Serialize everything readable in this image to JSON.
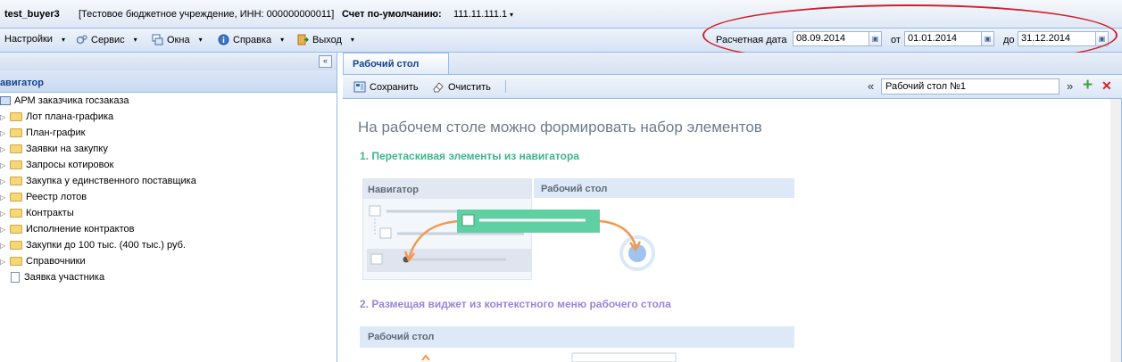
{
  "topbar": {
    "user": "test_buyer3",
    "org": "[Тестовое бюджетное учреждение, ИНН: 000000000011]",
    "account_label": "Счет по-умолчанию:",
    "account_value": "111.11.111.1",
    "account_caret": "▾"
  },
  "menu": {
    "items": [
      {
        "label": "Настройки",
        "icon": "settings-icon"
      },
      {
        "label": "Сервис",
        "icon": "service-icon"
      },
      {
        "label": "Окна",
        "icon": "windows-icon"
      },
      {
        "label": "Справка",
        "icon": "info-icon"
      },
      {
        "label": "Выход",
        "icon": "exit-icon"
      }
    ],
    "caret": "▾"
  },
  "dates": {
    "calc_label": "Расчетная дата",
    "calc_value": "08.09.2014",
    "from_label": "от",
    "from_value": "01.01.2014",
    "to_label": "до",
    "to_value": "31.12.2014"
  },
  "navigator": {
    "collapse_glyph": "«",
    "title": "Навигатор",
    "root": "АРМ заказчика госзаказа",
    "items": [
      "Лот плана-графика",
      "План-график",
      "Заявки на закупку",
      "Запросы котировок",
      "Закупка у единственного поставщика",
      "Реестр лотов",
      "Контракты",
      "Исполнение контрактов",
      "Закупки до 100 тыс. (400 тыс.) руб.",
      "Справочники"
    ],
    "doc_item": "Заявка участника"
  },
  "desktop": {
    "tab": "Рабочий стол",
    "save": "Сохранить",
    "clear": "Очистить",
    "prev": "«",
    "next": "»",
    "current": "Рабочий стол №1",
    "add": "+",
    "remove": "✕",
    "heading": "На рабочем столе можно формировать набор элементов",
    "step1": "1. Перетаскивая элементы из навигатора",
    "step1_nav_header": "Навигатор",
    "step1_desk_header": "Рабочий стол",
    "step2": "2. Размещая виджет из контекстного меню рабочего стола",
    "step2_desk_header": "Рабочий стол"
  },
  "colors": {
    "accent_blue": "#15428b",
    "border_blue": "#99bbe8",
    "green": "#3db58b",
    "purple": "#9c84d8",
    "highlight_red": "#d0202a",
    "drag_green": "#5fd0a2",
    "arrow_orange": "#f3984f"
  }
}
